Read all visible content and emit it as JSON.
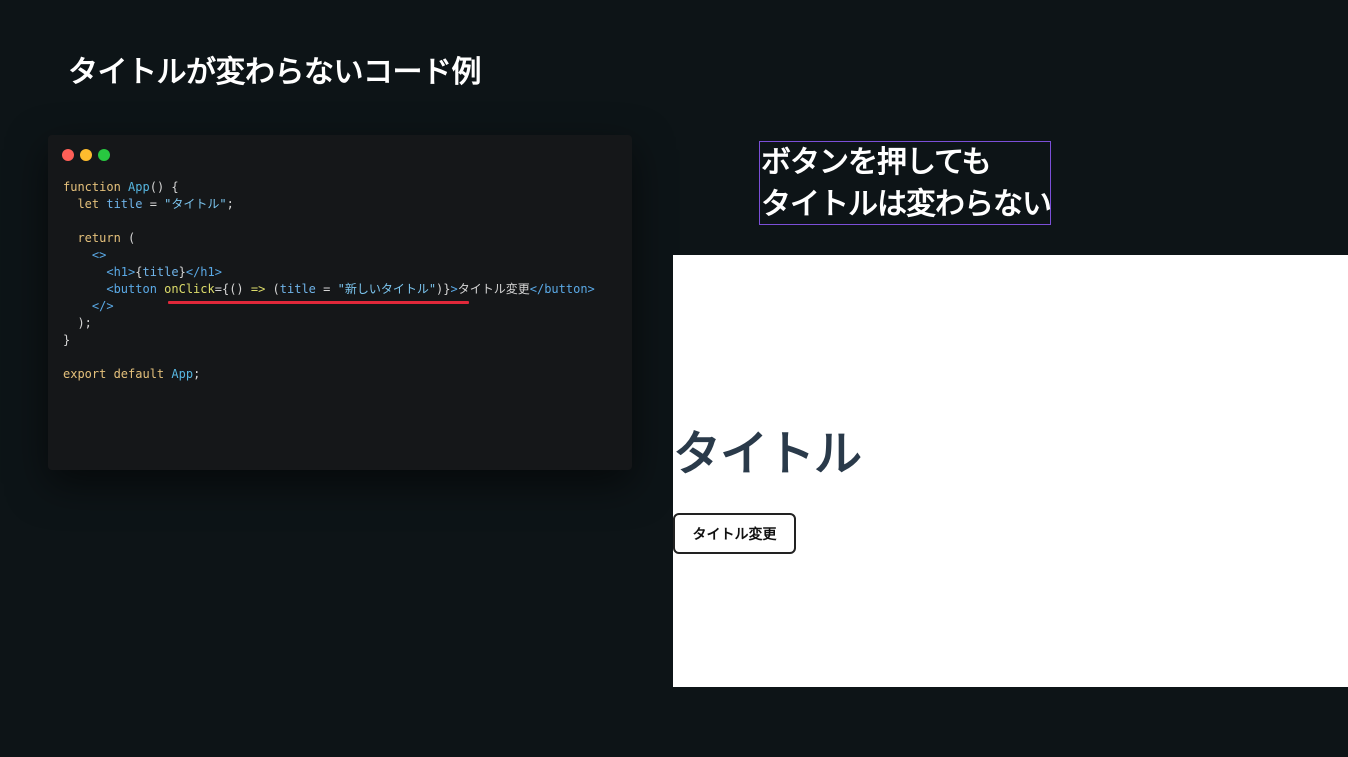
{
  "slide": {
    "title": "タイトルが変わらないコード例"
  },
  "code_window": {
    "lines": [
      [
        {
          "t": "function ",
          "c": "kw"
        },
        {
          "t": "App",
          "c": "fn"
        },
        {
          "t": "() {",
          "c": "op"
        }
      ],
      [
        {
          "t": "  let ",
          "c": "kw"
        },
        {
          "t": "title",
          "c": "vr"
        },
        {
          "t": " = ",
          "c": "op"
        },
        {
          "t": "\"タイトル\"",
          "c": "st"
        },
        {
          "t": ";",
          "c": "op"
        }
      ],
      [],
      [
        {
          "t": "  return ",
          "c": "kw"
        },
        {
          "t": "(",
          "c": "op"
        }
      ],
      [
        {
          "t": "    <>",
          "c": "tg"
        }
      ],
      [
        {
          "t": "      <h1>",
          "c": "tg"
        },
        {
          "t": "{",
          "c": "op"
        },
        {
          "t": "title",
          "c": "vr"
        },
        {
          "t": "}",
          "c": "op"
        },
        {
          "t": "</h1>",
          "c": "tg"
        }
      ],
      [
        {
          "t": "      <button ",
          "c": "tg"
        },
        {
          "t": "onClick",
          "c": "at"
        },
        {
          "t": "={",
          "c": "op"
        },
        {
          "t": "() ",
          "c": "op"
        },
        {
          "t": "=>",
          "c": "ar"
        },
        {
          "t": " (",
          "c": "op"
        },
        {
          "t": "title",
          "c": "vr"
        },
        {
          "t": " = ",
          "c": "op"
        },
        {
          "t": "\"新しいタイトル\"",
          "c": "st"
        },
        {
          "t": ")}",
          "c": "op"
        },
        {
          "t": ">",
          "c": "tg"
        },
        {
          "t": "タイトル変更",
          "c": "op"
        },
        {
          "t": "</button>",
          "c": "tg"
        }
      ],
      [
        {
          "t": "    </>",
          "c": "tg"
        }
      ],
      [
        {
          "t": "  );",
          "c": "op"
        }
      ],
      [
        {
          "t": "}",
          "c": "op"
        }
      ],
      [],
      [
        {
          "t": "export ",
          "c": "kw"
        },
        {
          "t": "default ",
          "c": "kw"
        },
        {
          "t": "App",
          "c": "fn"
        },
        {
          "t": ";",
          "c": "op"
        }
      ]
    ]
  },
  "callout": {
    "line1": "ボタンを押しても",
    "line2": "タイトルは変わらない"
  },
  "preview": {
    "heading": "タイトル",
    "button_label": "タイトル変更"
  },
  "colors": {
    "background": "#0d1417",
    "code_bg": "#151719",
    "underline": "#e0283a",
    "callout_border": "#7b4fd8",
    "heading": "#2a3a4a"
  }
}
